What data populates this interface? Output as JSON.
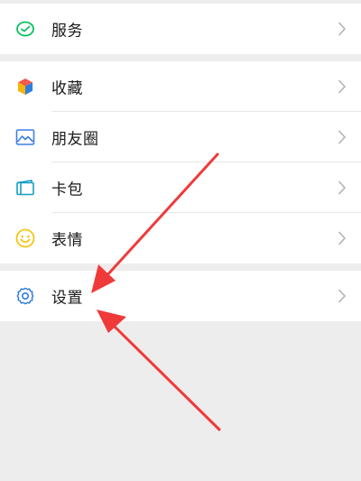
{
  "menu": {
    "service": {
      "label": "服务",
      "icon": "service-icon"
    },
    "favorites": {
      "label": "收藏",
      "icon": "favorites-icon"
    },
    "moments": {
      "label": "朋友圈",
      "icon": "moments-icon"
    },
    "cards": {
      "label": "卡包",
      "icon": "cards-icon"
    },
    "stickers": {
      "label": "表情",
      "icon": "stickers-icon"
    },
    "settings": {
      "label": "设置",
      "icon": "gear-icon"
    }
  },
  "colors": {
    "page_background": "#ededed",
    "row_background": "#ffffff",
    "text": "#191919",
    "chevron": "#b2b2b2",
    "arrow": "#f03a3a",
    "service_green": "#07c160",
    "moments_blue": "#3d7ee8",
    "cards_teal": "#13a0c2",
    "stickers_yellow": "#f2c811",
    "settings_blue": "#2e7be0"
  }
}
